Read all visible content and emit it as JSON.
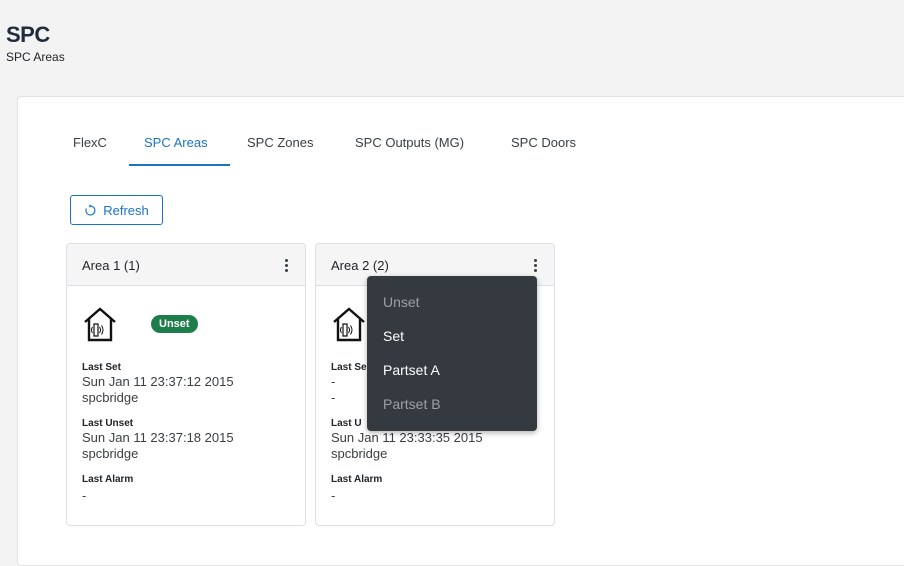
{
  "header": {
    "title": "SPC",
    "subtitle": "SPC Areas"
  },
  "tabs": [
    {
      "label": "FlexC",
      "active": false
    },
    {
      "label": "SPC Areas",
      "active": true
    },
    {
      "label": "SPC Zones",
      "active": false
    },
    {
      "label": "SPC Outputs (MG)",
      "active": false
    },
    {
      "label": "SPC Doors",
      "active": false
    }
  ],
  "toolbar": {
    "refresh_label": "Refresh",
    "refresh_icon": "refresh-icon"
  },
  "areas": [
    {
      "title": "Area 1 (1)",
      "status": "Unset",
      "status_color": "#1e7e4b",
      "last_set_label": "Last Set",
      "last_set_time": "Sun Jan 11 23:37:12 2015",
      "last_set_user": "spcbridge",
      "last_unset_label": "Last Unset",
      "last_unset_time": "Sun Jan 11 23:37:18 2015",
      "last_unset_user": "spcbridge",
      "last_alarm_label": "Last Alarm",
      "last_alarm_value": "-"
    },
    {
      "title": "Area 2 (2)",
      "last_set_label": "Last Se",
      "last_set_time": "-",
      "last_set_user": "-",
      "last_unset_label": "Last U",
      "last_unset_time": "Sun Jan 11 23:33:35 2015",
      "last_unset_user": "spcbridge",
      "last_alarm_label": "Last Alarm",
      "last_alarm_value": "-"
    }
  ],
  "dropdown_menu": [
    {
      "label": "Unset",
      "enabled": false
    },
    {
      "label": "Set",
      "enabled": true
    },
    {
      "label": "Partset A",
      "enabled": true
    },
    {
      "label": "Partset B",
      "enabled": false
    }
  ],
  "colors": {
    "accent": "#1a73c9",
    "menu_bg": "#343a40",
    "status_unset": "#1e7e4b"
  }
}
